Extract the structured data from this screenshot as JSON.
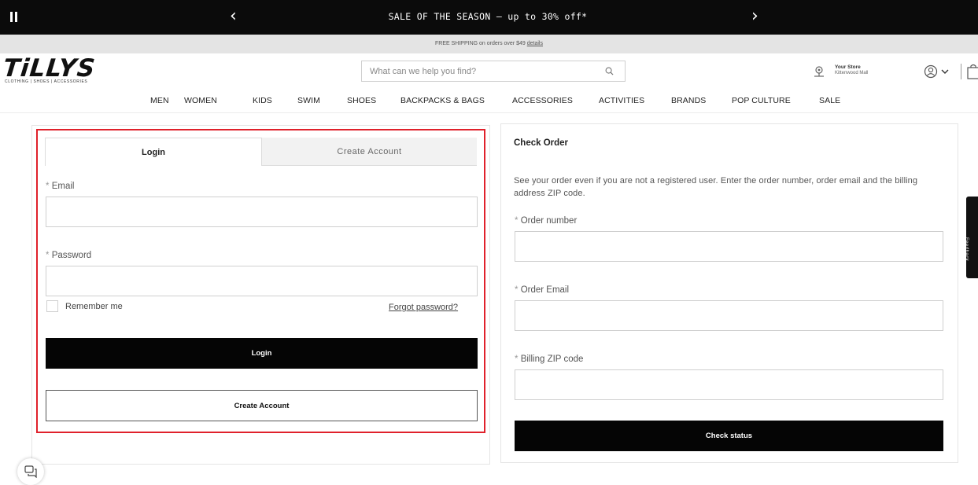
{
  "promo": {
    "message": "SALE OF THE SEASON – up to 30% off*",
    "prev_glyph": "‹",
    "next_glyph": "›"
  },
  "shipping": {
    "text": "FREE SHIPPING on orders over $49",
    "link": "details"
  },
  "header": {
    "logo_text": "TiLLYS",
    "logo_tagline": "CLOTHING | SHOES | ACCESSORIES",
    "search_placeholder": "What can we help you find?",
    "store_label": "Your Store",
    "store_name": "Kittenwood Mall"
  },
  "nav": {
    "items": [
      "MEN",
      "WOMEN",
      "KIDS",
      "SWIM",
      "SHOES",
      "BACKPACKS & BAGS",
      "ACCESSORIES",
      "ACTIVITIES",
      "BRANDS",
      "POP CULTURE",
      "SALE"
    ]
  },
  "login": {
    "tab_login": "Login",
    "tab_create": "Create Account",
    "required_mark": "*",
    "email_label": "Email",
    "password_label": "Password",
    "remember_label": "Remember me",
    "forgot_label": "Forgot password?",
    "login_button": "Login",
    "create_button": "Create Account"
  },
  "check_order": {
    "title": "Check Order",
    "description": "See your order even if you are not a registered user. Enter the order number, order email and the billing address ZIP code.",
    "order_number_label": "Order number",
    "order_email_label": "Order Email",
    "zip_label": "Billing ZIP code",
    "submit_button": "Check status"
  },
  "feedback": {
    "label": "Feedback"
  },
  "colors": {
    "promo_bg": "#0b0b0b",
    "button_bg": "#050505",
    "highlight": "#e0212b"
  }
}
